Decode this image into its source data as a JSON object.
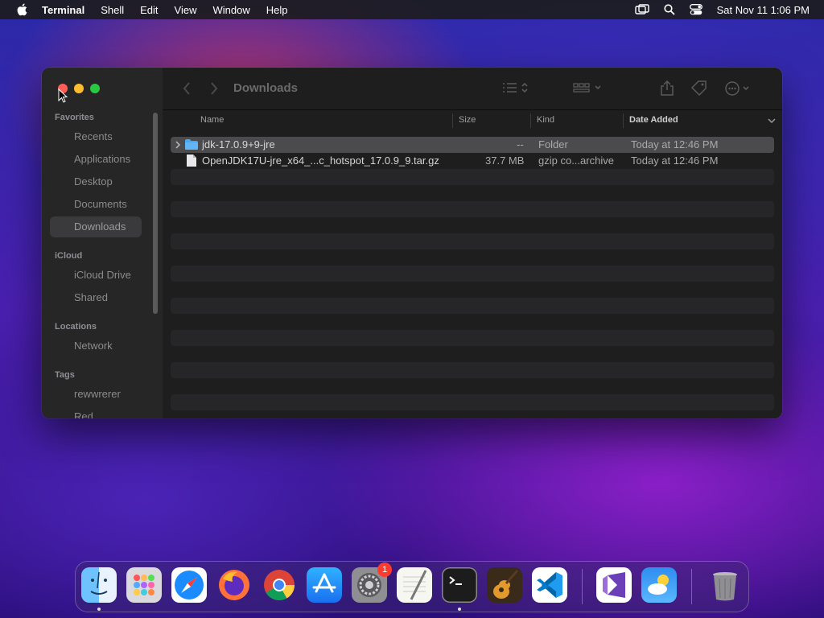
{
  "menubar": {
    "app_name": "Terminal",
    "items": [
      "Shell",
      "Edit",
      "View",
      "Window",
      "Help"
    ],
    "datetime": "Sat Nov 11  1:06 PM"
  },
  "finder": {
    "title": "Downloads",
    "sidebar": {
      "favorites_header": "Favorites",
      "favorites": [
        "Recents",
        "Applications",
        "Desktop",
        "Documents",
        "Downloads"
      ],
      "selected": "Downloads",
      "icloud_header": "iCloud",
      "icloud": [
        "iCloud Drive",
        "Shared"
      ],
      "locations_header": "Locations",
      "locations": [
        "Network"
      ],
      "tags_header": "Tags",
      "tags": [
        "rewwrerer",
        "Red"
      ]
    },
    "columns": {
      "name": "Name",
      "size": "Size",
      "kind": "Kind",
      "date_added": "Date Added"
    },
    "files": [
      {
        "name": "jdk-17.0.9+9-jre",
        "size": "--",
        "kind": "Folder",
        "date_added": "Today at 12:46 PM"
      },
      {
        "name": "OpenJDK17U-jre_x64_...c_hotspot_17.0.9_9.tar.gz",
        "size": "37.7 MB",
        "kind": "gzip co...archive",
        "date_added": "Today at 12:46 PM"
      }
    ]
  },
  "dock": {
    "apps": [
      "Finder",
      "Launchpad",
      "Safari",
      "Firefox",
      "Chrome",
      "App Store",
      "System Settings",
      "TextEdit",
      "Terminal",
      "GarageBand",
      "Visual Studio Code",
      "Visual Studio",
      "Weather",
      "Trash"
    ],
    "settings_badge": "1"
  },
  "colors": {
    "close": "#ff5f57",
    "minimize": "#febc2e",
    "zoom": "#28c840",
    "folder_blue": "#4aa8f0"
  }
}
